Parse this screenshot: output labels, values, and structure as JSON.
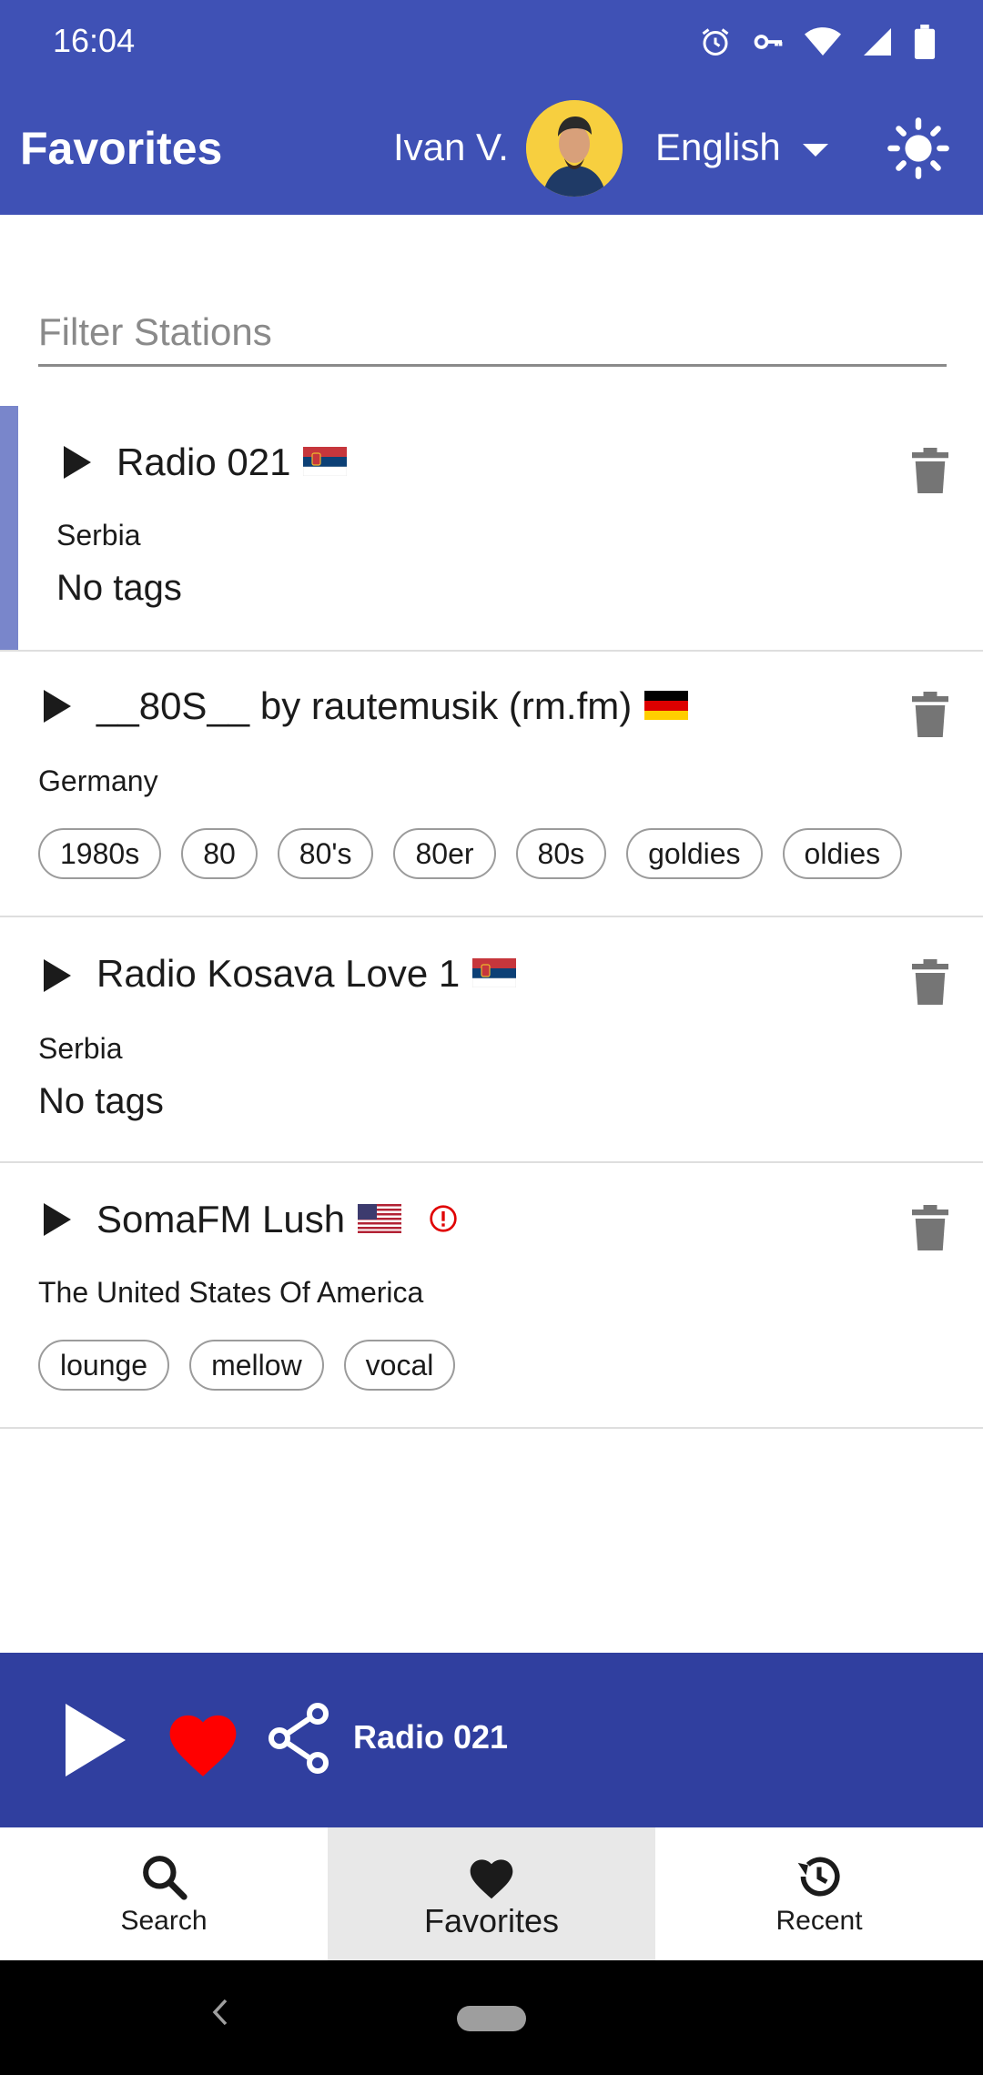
{
  "status_bar": {
    "time": "16:04",
    "icons": [
      "alarm-icon",
      "vpn-key-icon",
      "wifi-icon",
      "signal-icon",
      "battery-icon"
    ]
  },
  "app_bar": {
    "title": "Favorites",
    "user_name": "Ivan V.",
    "language": "English",
    "theme_icon": "sun-icon"
  },
  "filter": {
    "placeholder": "Filter Stations",
    "value": ""
  },
  "stations": [
    {
      "title": "Radio 021",
      "flag": "Serbia",
      "country": "Serbia",
      "no_tags": "No tags",
      "tags": [],
      "selected": true
    },
    {
      "title": "__80S__ by rautemusik (rm.fm)",
      "flag": "Germany",
      "country": "Germany",
      "tags": [
        "1980s",
        "80",
        "80's",
        "80er",
        "80s",
        "goldies",
        "oldies"
      ]
    },
    {
      "title": "Radio Kosava Love 1",
      "flag": "Serbia",
      "country": "Serbia",
      "no_tags": "No tags",
      "tags": []
    },
    {
      "title": "SomaFM Lush",
      "flag": "USA",
      "country": "The United States Of America",
      "tags": [
        "lounge",
        "mellow",
        "vocal"
      ],
      "warning": true
    }
  ],
  "player": {
    "now_playing": "Radio 021"
  },
  "bottom_nav": {
    "items": [
      {
        "label": "Search",
        "icon": "search-icon"
      },
      {
        "label": "Favorites",
        "icon": "heart-icon",
        "active": true
      },
      {
        "label": "Recent",
        "icon": "history-icon"
      }
    ]
  },
  "colors": {
    "primary": "#3f51b5",
    "player": "#303f9f",
    "accent_bar": "#7986cb",
    "heart": "#ff0000",
    "warning": "#e00000"
  }
}
